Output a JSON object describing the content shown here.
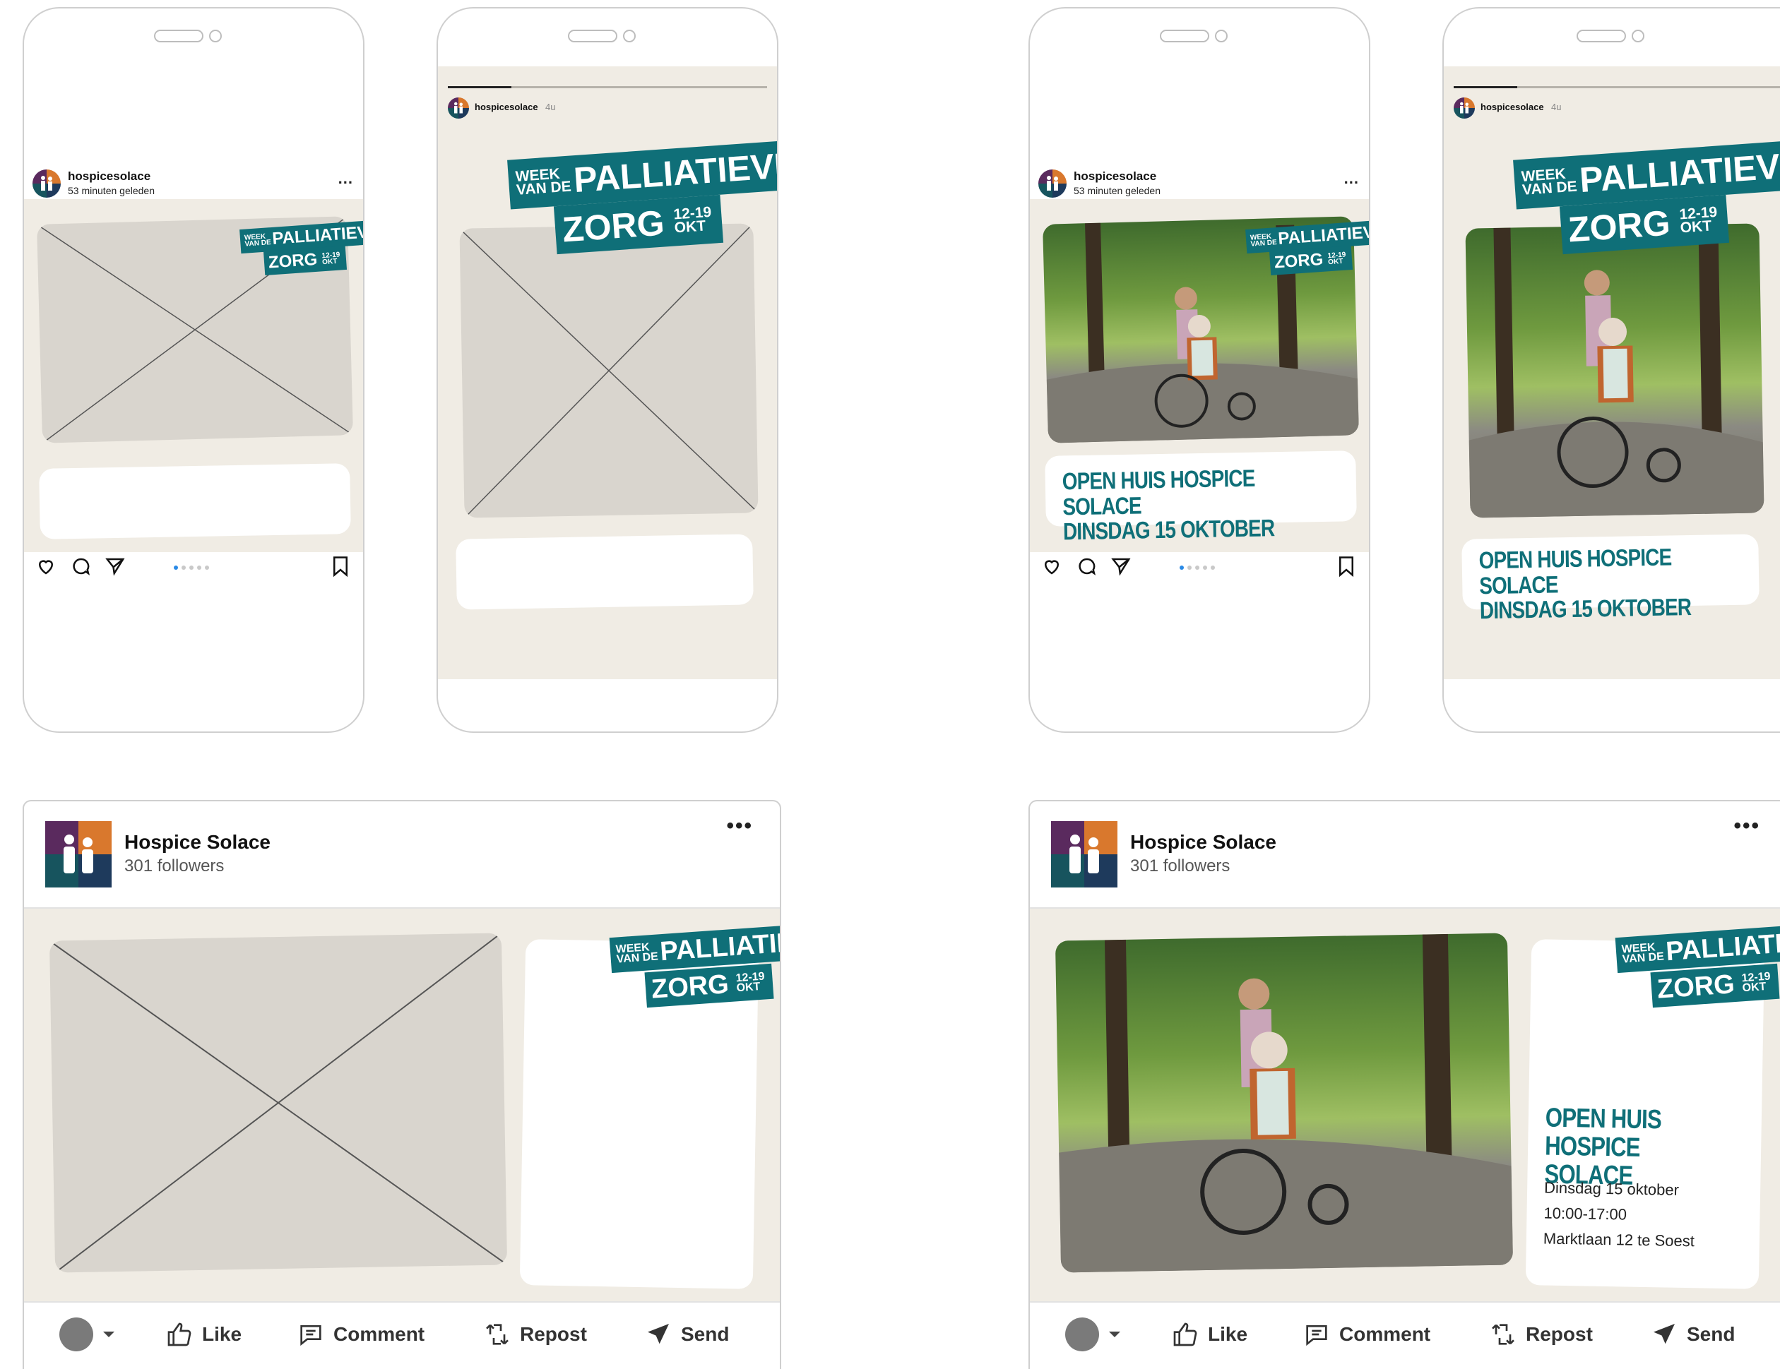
{
  "instagram": {
    "username": "hospicesolace",
    "time": "53 minuten geleden",
    "more": "...",
    "story_time": "4u"
  },
  "badge": {
    "week": "WEEK",
    "vande": "VAN DE",
    "palliatieve": "PALLIATIEVE",
    "zorg": "ZORG",
    "dates": "12-19",
    "okt": "OKT"
  },
  "event": {
    "line1": "OPEN HUIS HOSPICE SOLACE",
    "line2": "DINSDAG 15 OKTOBER",
    "li_line1": "OPEN HUIS",
    "li_line2": "HOSPICE SOLACE",
    "date": "Dinsdag 15 oktober",
    "hours": "10:00-17:00",
    "address": "Marktlaan 12 te Soest"
  },
  "linkedin": {
    "name": "Hospice Solace",
    "followers": "301 followers",
    "more": "•••",
    "like": "Like",
    "comment": "Comment",
    "repost": "Repost",
    "send": "Send"
  },
  "colors": {
    "brand_teal": "#0f6f78",
    "bg_beige": "#f0ece4",
    "placeholder": "#d9d5ce"
  }
}
